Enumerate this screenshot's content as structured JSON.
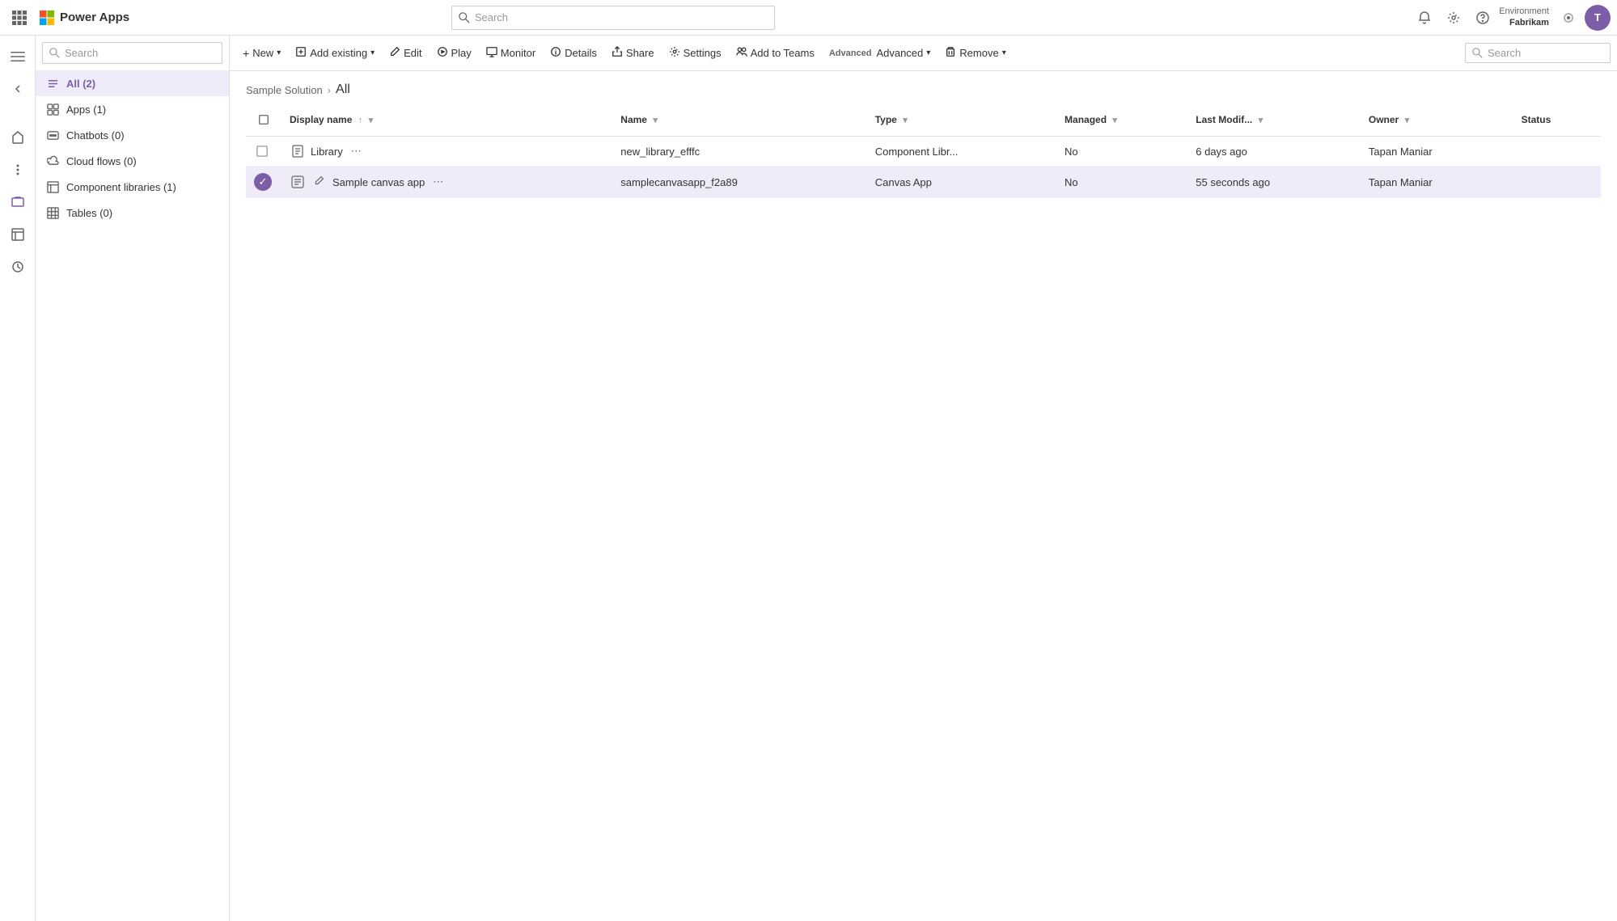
{
  "topNav": {
    "appName": "Power Apps",
    "searchPlaceholder": "Search",
    "env": {
      "label": "Environment",
      "name": "Fabrikam"
    },
    "avatarInitial": "T"
  },
  "sidebar": {
    "searchPlaceholder": "Search",
    "items": [
      {
        "id": "all",
        "label": "All (2)",
        "icon": "list"
      },
      {
        "id": "apps",
        "label": "Apps (1)",
        "icon": "apps"
      },
      {
        "id": "chatbots",
        "label": "Chatbots (0)",
        "icon": "chatbot"
      },
      {
        "id": "cloudflows",
        "label": "Cloud flows (0)",
        "icon": "flow"
      },
      {
        "id": "complibs",
        "label": "Component libraries (1)",
        "icon": "table"
      },
      {
        "id": "tables",
        "label": "Tables (0)",
        "icon": "grid"
      }
    ]
  },
  "commandBar": {
    "buttons": [
      {
        "id": "new",
        "label": "New",
        "icon": "+",
        "hasDropdown": true
      },
      {
        "id": "addexisting",
        "label": "Add existing",
        "icon": "📋",
        "hasDropdown": true
      },
      {
        "id": "edit",
        "label": "Edit",
        "icon": "✏️",
        "hasDropdown": false
      },
      {
        "id": "play",
        "label": "Play",
        "icon": "▶",
        "hasDropdown": false
      },
      {
        "id": "monitor",
        "label": "Monitor",
        "icon": "⊞",
        "hasDropdown": false
      },
      {
        "id": "details",
        "label": "Details",
        "icon": "ℹ",
        "hasDropdown": false
      },
      {
        "id": "share",
        "label": "Share",
        "icon": "↗",
        "hasDropdown": false
      },
      {
        "id": "settings",
        "label": "Settings",
        "icon": "⚙",
        "hasDropdown": false
      },
      {
        "id": "addtoteams",
        "label": "Add to Teams",
        "icon": "👥",
        "hasDropdown": false
      },
      {
        "id": "advanced",
        "label": "Advanced",
        "icon": "IX",
        "hasDropdown": true
      },
      {
        "id": "remove",
        "label": "Remove",
        "icon": "🗑",
        "hasDropdown": true
      }
    ],
    "searchPlaceholder": "Search"
  },
  "breadcrumb": {
    "parent": "Sample Solution",
    "current": "All"
  },
  "table": {
    "columns": [
      {
        "id": "displayname",
        "label": "Display name",
        "sortable": true,
        "sorted": "asc"
      },
      {
        "id": "name",
        "label": "Name",
        "sortable": true
      },
      {
        "id": "type",
        "label": "Type",
        "sortable": true
      },
      {
        "id": "managed",
        "label": "Managed",
        "sortable": true
      },
      {
        "id": "lastmodif",
        "label": "Last Modif...",
        "sortable": true
      },
      {
        "id": "owner",
        "label": "Owner",
        "sortable": true
      },
      {
        "id": "status",
        "label": "Status",
        "sortable": false
      }
    ],
    "rows": [
      {
        "id": "row1",
        "displayName": "Library",
        "name": "new_library_efffc",
        "type": "Component Libr...",
        "managed": "No",
        "lastModified": "6 days ago",
        "owner": "Tapan Maniar",
        "status": "",
        "selected": false,
        "iconType": "component"
      },
      {
        "id": "row2",
        "displayName": "Sample canvas app",
        "name": "samplecanvasapp_f2a89",
        "type": "Canvas App",
        "managed": "No",
        "lastModified": "55 seconds ago",
        "owner": "Tapan Maniar",
        "status": "",
        "selected": true,
        "iconType": "canvas"
      }
    ]
  }
}
